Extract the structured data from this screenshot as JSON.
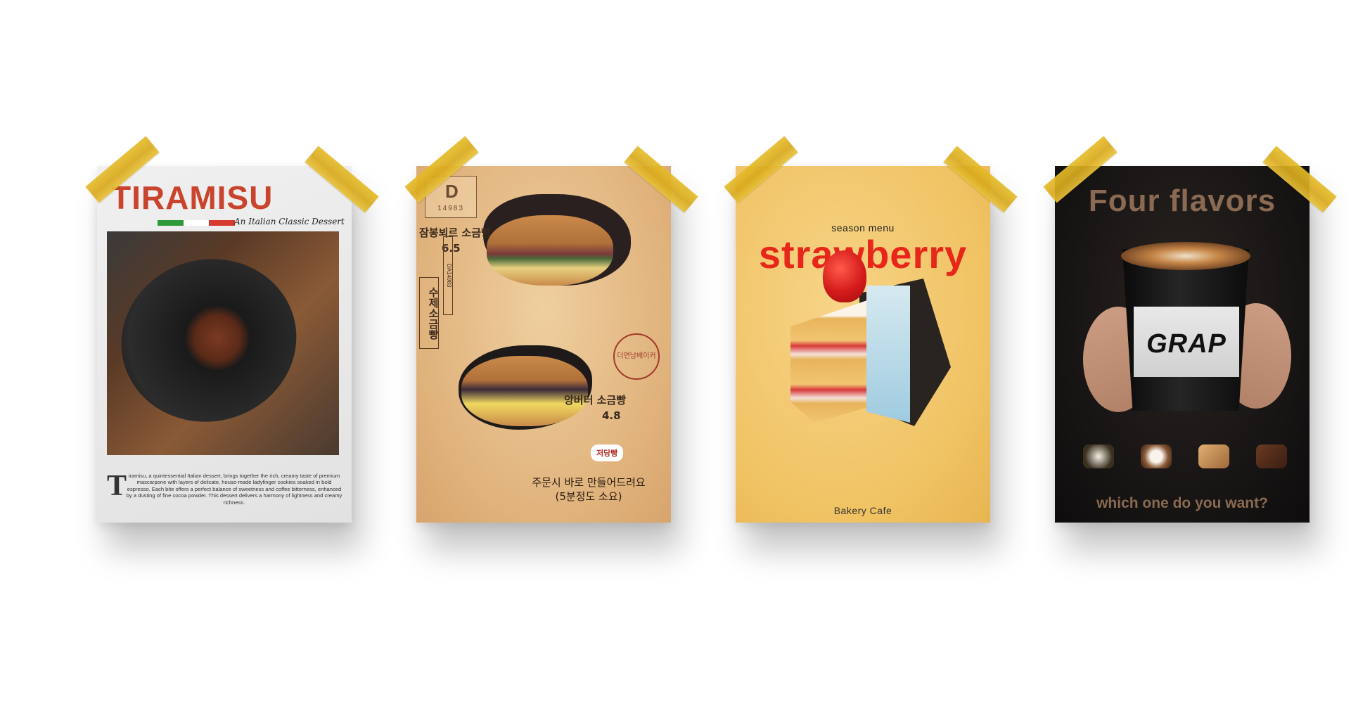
{
  "posters": {
    "tiramisu": {
      "title": "TIRAMISU",
      "subtitle": "An Italian Classic Dessert",
      "flag_colors": [
        "#2e9a3a",
        "#ffffff",
        "#d73a2f"
      ],
      "drop_cap": "T",
      "body": "iramisu, a quintessential Italian dessert, brings together the rich, creamy taste of premium mascarpone with layers of delicate, house-made ladyfinger cookies soaked in bold espresso. Each bite offers a perfect balance of sweetness and coffee bitterness, enhanced by a dusting of fine cocoa powder. This dessert delivers a harmony of lightness and creamy richness."
    },
    "sandwich": {
      "logo_letter": "D",
      "logo_number": "14983",
      "item1_name": "잠봉뵈르 소금빵",
      "item1_price": "6.5",
      "vertical_label": "수제소금빵",
      "vertical_small": "DA14983",
      "stamp_text": "더연남베이커",
      "item2_name": "앙버터 소금빵",
      "item2_price": "4.8",
      "tag": "저당빵",
      "bottom_line1": "주문시 바로 만들어드려요",
      "bottom_line2": "(5분정도 소요)"
    },
    "strawberry": {
      "season": "season menu",
      "title": "strawberry",
      "footer": "Bakery Cafe"
    },
    "coffee": {
      "title": "Four flavors",
      "brand": "GRAP",
      "question": "which one do you want?",
      "ingredients": [
        "vanilla-icon",
        "coconut-icon",
        "caramel-icon",
        "chocolate-icon"
      ]
    }
  },
  "colors": {
    "tape": "#e0b424",
    "tiramisu_red": "#c8442c",
    "strawberry_red": "#e8271b",
    "coffee_text": "#8a6a52"
  }
}
